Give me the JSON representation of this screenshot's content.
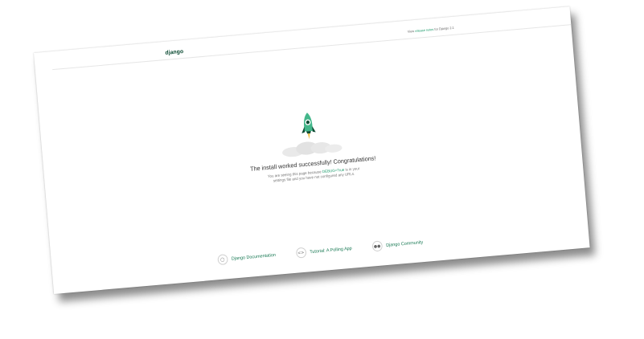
{
  "header": {
    "brand": "django",
    "release_prefix": "View ",
    "release_link": "release notes",
    "release_suffix": " for Django 2.1"
  },
  "hero": {
    "headline": "The install worked successfully! Congratulations!",
    "sub_before": "You are seeing this page because ",
    "sub_code": "DEBUG=True",
    "sub_after": " is in your settings file and you have not configured any URLs."
  },
  "footer": {
    "items": [
      {
        "label": "Django Documentation",
        "icon": "lightbulb-icon"
      },
      {
        "label": "Tutorial: A Polling App",
        "icon": "code-icon"
      },
      {
        "label": "Django Community",
        "icon": "people-icon"
      }
    ]
  },
  "colors": {
    "brand": "#0c4b33",
    "link": "#1a9a6a",
    "rocket": "#44b78b"
  }
}
